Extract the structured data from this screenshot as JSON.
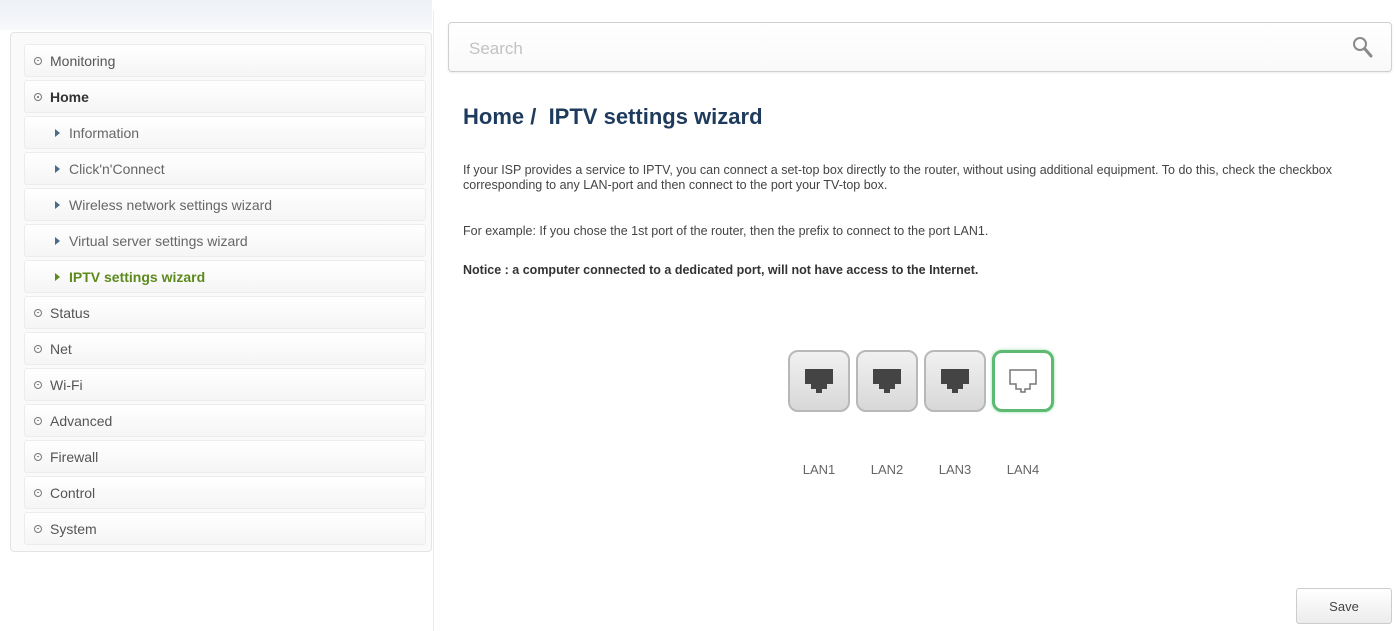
{
  "sidebar": {
    "items": [
      {
        "label": "Monitoring"
      },
      {
        "label": "Home",
        "open": true
      },
      {
        "label": "Information",
        "sub": true
      },
      {
        "label": "Click'n'Connect",
        "sub": true
      },
      {
        "label": "Wireless network settings wizard",
        "sub": true
      },
      {
        "label": "Virtual server settings wizard",
        "sub": true
      },
      {
        "label": "IPTV settings wizard",
        "sub": true,
        "active": true
      },
      {
        "label": "Status"
      },
      {
        "label": "Net"
      },
      {
        "label": "Wi-Fi"
      },
      {
        "label": "Advanced"
      },
      {
        "label": "Firewall"
      },
      {
        "label": "Control"
      },
      {
        "label": "System"
      }
    ]
  },
  "search": {
    "placeholder": "Search",
    "value": "",
    "icon": "search-icon"
  },
  "main": {
    "title": "Home /  IPTV settings wizard",
    "description": "If your ISP provides a service to IPTV, you can connect a set-top box directly to the router, without using additional equipment. To do this, check the checkbox corresponding to any LAN-port and then connect to the port your TV-top box.",
    "example": "For example: If you chose the 1st port of the router, then the prefix to connect to the port LAN1.",
    "notice": "Notice : a computer connected to a dedicated port, will not have access to the Internet.",
    "ports": [
      {
        "label": "LAN1",
        "checked": false
      },
      {
        "label": "LAN2",
        "checked": false
      },
      {
        "label": "LAN3",
        "checked": false
      },
      {
        "label": "LAN4",
        "checked": true
      }
    ],
    "save_label": "Save"
  },
  "colors": {
    "title": "#1e3a5c",
    "active_menu": "#5d8a1c",
    "port_checked_border": "#5cba72"
  }
}
